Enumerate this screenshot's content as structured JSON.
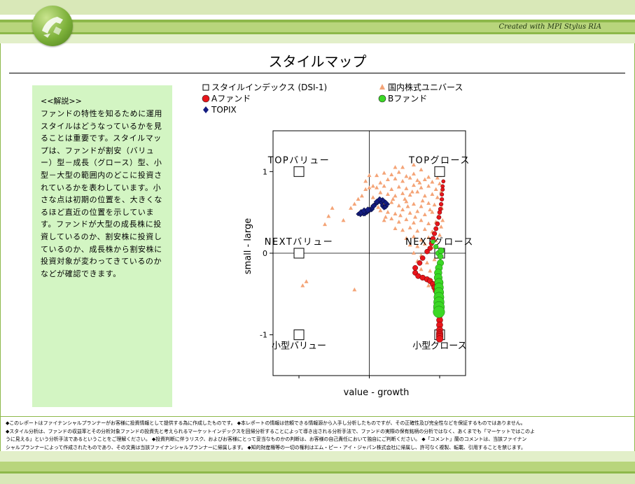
{
  "header": {
    "credit": "Created with MPI Stylus RIA"
  },
  "page_title": "スタイルマップ",
  "note": {
    "title": "<<解説>>",
    "body": "ファンドの特性を知るために運用スタイルはどうなっているかを見ることは重要です。スタイルマップは、ファンドが割安（バリュー）型－成長（グロース）型、小型－大型の範囲内のどこに投資されているかを表わしています。小さな点は初期の位置を、大きくなるほど直近の位置を示しています。ファンドが大型の成長株に投資しているのか、割安株に投資しているのか、成長株から割安株に投資対象が変わってきているのかなどが確認できます。"
  },
  "footer": {
    "lines": [
      "◆このレポートはファイナンシャルプランナーがお客様に投資情報として提供する為に作成したものです。 ◆本レポートの情報は信頼できる情報源から入手し分析したものですが、その正確性及び完全性などを保証するものではありません。",
      "◆スタイル分析は、ファンドの収益率とその分析対象ファンドの投資先と考えられるマーケットインデックスを回帰分析することによって導き出される分析手法で、ファンドの実際の保有銘柄の分析ではなく、あくまでも「マーケットではこのよ",
      "うに見える」という分析手法であるということをご理解ください。 ◆投資判断に伴うリスク、およびお客様にとって妥当なものかの判断は、お客様の自己責任において独自にご判断ください。 ◆「コメント」蘭のコメントは、当該ファイナン",
      "シャルプランナーによって作成されたものであり、その文責は当該ファイナンシャルプランナーに帰属します。 ◆知的財産権等の一切の権利はエム・ピー・アイ・ジャパン株式会社に帰属し、許可なく複製、転載、引用することを禁じます。"
    ]
  },
  "colors": {
    "band_dark": "#8db84a",
    "band_mid": "#b8d57c",
    "band_light": "#e2efc9",
    "note_bg": "#d3f5c3",
    "universe": "#f4a477",
    "fund_a": "#e8151b",
    "fund_b": "#3bd825",
    "topix": "#131c80"
  },
  "chart_data": {
    "type": "scatter",
    "xlabel": "value - growth",
    "ylabel": "small - large",
    "xlim": [
      -1.3,
      1.3
    ],
    "ylim": [
      -1.5,
      1.5
    ],
    "yticks": [
      "1",
      "0",
      "-1"
    ],
    "grid_cross": [
      0,
      0
    ],
    "legend": [
      {
        "label": "スタイルインデックス (DSI-1)",
        "marker": "square-open"
      },
      {
        "label": "国内株式ユニバース",
        "marker": "triangle"
      },
      {
        "label": "Aファンド",
        "marker": "circle"
      },
      {
        "label": "Bファンド",
        "marker": "circle"
      },
      {
        "label": "TOPIX",
        "marker": "diamond"
      }
    ],
    "style_indices": [
      {
        "label": "TOPバリュー",
        "x": -0.95,
        "y": 1.0
      },
      {
        "label": "TOPグロース",
        "x": 0.95,
        "y": 1.0
      },
      {
        "label": "NEXTバリュー",
        "x": -0.95,
        "y": 0.0
      },
      {
        "label": "NEXTグロース",
        "x": 0.95,
        "y": 0.0
      },
      {
        "label": "小型バリュー",
        "x": -0.95,
        "y": -1.0
      },
      {
        "label": "小型グロース",
        "x": 0.95,
        "y": -1.0
      }
    ],
    "series": [
      {
        "name": "国内株式ユニバース",
        "points": [
          [
            0.1,
            0.95
          ],
          [
            0.2,
            0.98
          ],
          [
            0.3,
            0.96
          ],
          [
            0.4,
            0.99
          ],
          [
            0.5,
            0.94
          ],
          [
            0.6,
            0.97
          ],
          [
            0.7,
            1.02
          ],
          [
            0.8,
            0.93
          ],
          [
            0.9,
            0.99
          ],
          [
            0.25,
            0.9
          ],
          [
            0.35,
            0.91
          ],
          [
            0.45,
            0.88
          ],
          [
            0.55,
            0.92
          ],
          [
            0.65,
            0.89
          ],
          [
            0.75,
            0.9
          ],
          [
            0.85,
            0.87
          ],
          [
            0.15,
            0.86
          ],
          [
            0.05,
            0.82
          ],
          [
            0.0,
            0.8
          ],
          [
            -0.05,
            0.78
          ],
          [
            0.1,
            0.8
          ],
          [
            0.2,
            0.82
          ],
          [
            0.3,
            0.78
          ],
          [
            0.4,
            0.81
          ],
          [
            0.5,
            0.79
          ],
          [
            0.6,
            0.83
          ],
          [
            0.7,
            0.8
          ],
          [
            0.8,
            0.82
          ],
          [
            0.9,
            0.78
          ],
          [
            0.95,
            0.85
          ],
          [
            0.15,
            0.74
          ],
          [
            0.25,
            0.72
          ],
          [
            0.35,
            0.7
          ],
          [
            0.45,
            0.73
          ],
          [
            0.55,
            0.71
          ],
          [
            0.65,
            0.75
          ],
          [
            0.75,
            0.7
          ],
          [
            0.85,
            0.72
          ],
          [
            0.92,
            0.68
          ],
          [
            -0.1,
            0.7
          ],
          [
            -0.15,
            0.66
          ],
          [
            0.05,
            0.68
          ],
          [
            0.1,
            0.64
          ],
          [
            0.2,
            0.6
          ],
          [
            0.3,
            0.62
          ],
          [
            0.4,
            0.58
          ],
          [
            0.5,
            0.63
          ],
          [
            0.6,
            0.6
          ],
          [
            0.7,
            0.57
          ],
          [
            0.8,
            0.61
          ],
          [
            0.88,
            0.59
          ],
          [
            -0.2,
            0.6
          ],
          [
            -0.25,
            0.55
          ],
          [
            0.15,
            0.52
          ],
          [
            0.25,
            0.5
          ],
          [
            0.35,
            0.48
          ],
          [
            0.45,
            0.53
          ],
          [
            0.55,
            0.49
          ],
          [
            0.65,
            0.51
          ],
          [
            0.75,
            0.47
          ],
          [
            0.85,
            0.5
          ],
          [
            0.93,
            0.45
          ],
          [
            0.2,
            0.4
          ],
          [
            0.3,
            0.42
          ],
          [
            0.4,
            0.38
          ],
          [
            0.5,
            0.41
          ],
          [
            0.6,
            0.37
          ],
          [
            0.7,
            0.4
          ],
          [
            0.8,
            0.36
          ],
          [
            0.9,
            0.38
          ],
          [
            0.97,
            0.32
          ],
          [
            0.35,
            0.3
          ],
          [
            0.45,
            0.28
          ],
          [
            0.55,
            0.31
          ],
          [
            0.65,
            0.27
          ],
          [
            0.75,
            0.29
          ],
          [
            0.85,
            0.26
          ],
          [
            0.95,
            0.22
          ],
          [
            0.5,
            0.18
          ],
          [
            0.6,
            0.2
          ],
          [
            0.7,
            0.16
          ],
          [
            0.8,
            0.19
          ],
          [
            0.9,
            0.15
          ],
          [
            0.55,
            0.1
          ],
          [
            0.65,
            0.08
          ],
          [
            0.75,
            0.11
          ],
          [
            0.85,
            0.07
          ],
          [
            0.95,
            0.05
          ],
          [
            0.6,
            0.0
          ],
          [
            0.7,
            -0.03
          ],
          [
            0.8,
            0.02
          ],
          [
            0.9,
            -0.05
          ],
          [
            0.65,
            -0.1
          ],
          [
            0.78,
            -0.12
          ],
          [
            0.88,
            -0.08
          ],
          [
            0.7,
            -0.2
          ],
          [
            0.82,
            -0.22
          ],
          [
            0.95,
            -0.18
          ],
          [
            0.75,
            -0.3
          ],
          [
            0.9,
            -0.33
          ],
          [
            0.8,
            -0.4
          ],
          [
            0.95,
            0.95
          ],
          [
            0.97,
            0.75
          ],
          [
            0.98,
            0.55
          ],
          [
            0.99,
            0.4
          ],
          [
            -0.85,
            -0.35
          ],
          [
            -0.9,
            -0.4
          ],
          [
            -0.2,
            -0.45
          ],
          [
            -0.35,
            0.4
          ],
          [
            -0.5,
            0.55
          ],
          [
            -0.6,
            0.35
          ],
          [
            -0.55,
            0.45
          ],
          [
            0.0,
            0.95
          ],
          [
            0.45,
            1.05
          ],
          [
            0.6,
            1.08
          ],
          [
            0.35,
            1.05
          ],
          [
            -0.05,
            0.88
          ],
          [
            0.22,
            0.44
          ],
          [
            0.12,
            0.56
          ],
          [
            0.32,
            0.66
          ],
          [
            0.42,
            0.46
          ],
          [
            0.52,
            0.57
          ],
          [
            0.62,
            0.44
          ],
          [
            0.72,
            0.64
          ],
          [
            0.82,
            0.53
          ],
          [
            0.92,
            0.92
          ],
          [
            0.68,
            0.86
          ],
          [
            0.58,
            0.75
          ],
          [
            0.48,
            0.66
          ]
        ]
      },
      {
        "name": "TOPIX",
        "points": [
          [
            -0.15,
            0.48
          ],
          [
            -0.12,
            0.47
          ],
          [
            -0.09,
            0.49
          ],
          [
            -0.06,
            0.48
          ],
          [
            -0.03,
            0.5
          ],
          [
            0.0,
            0.52
          ],
          [
            0.03,
            0.55
          ],
          [
            0.05,
            0.58
          ],
          [
            0.08,
            0.6
          ],
          [
            0.11,
            0.62
          ],
          [
            0.13,
            0.64
          ],
          [
            0.16,
            0.62
          ],
          [
            0.18,
            0.58
          ],
          [
            0.2,
            0.56
          ],
          [
            0.22,
            0.57
          ],
          [
            0.24,
            0.6
          ],
          [
            0.22,
            0.62
          ],
          [
            0.18,
            0.65
          ],
          [
            0.14,
            0.66
          ],
          [
            0.1,
            0.63
          ],
          [
            0.06,
            0.58
          ],
          [
            0.03,
            0.54
          ],
          [
            0.0,
            0.53
          ],
          [
            -0.04,
            0.51
          ],
          [
            -0.08,
            0.49
          ],
          [
            -0.11,
            0.5
          ],
          [
            -0.07,
            0.52
          ],
          [
            -0.02,
            0.53
          ]
        ]
      },
      {
        "name": "Aファンド",
        "points": [
          [
            1.0,
            0.88
          ],
          [
            0.99,
            0.82
          ],
          [
            0.99,
            0.78
          ],
          [
            0.98,
            0.72
          ],
          [
            0.98,
            0.66
          ],
          [
            0.97,
            0.6
          ],
          [
            0.96,
            0.54
          ],
          [
            0.95,
            0.5
          ],
          [
            0.94,
            0.44
          ],
          [
            0.92,
            0.36
          ],
          [
            0.9,
            0.3
          ],
          [
            0.88,
            0.24
          ],
          [
            0.86,
            0.18
          ],
          [
            0.84,
            0.12
          ],
          [
            0.82,
            0.06
          ],
          [
            0.78,
            0.02
          ],
          [
            0.72,
            -0.06
          ],
          [
            0.68,
            -0.12
          ],
          [
            0.62,
            -0.18
          ],
          [
            0.62,
            -0.24
          ],
          [
            0.66,
            -0.28
          ],
          [
            0.72,
            -0.3
          ],
          [
            0.78,
            -0.32
          ],
          [
            0.82,
            -0.34
          ],
          [
            0.86,
            -0.38
          ],
          [
            0.88,
            -0.42
          ],
          [
            0.9,
            -0.46
          ],
          [
            0.92,
            -0.52
          ],
          [
            0.93,
            -0.58
          ],
          [
            0.94,
            -0.64
          ],
          [
            0.94,
            -0.7
          ],
          [
            0.95,
            -0.76
          ],
          [
            0.95,
            -0.82
          ],
          [
            0.95,
            -0.88
          ],
          [
            0.95,
            -0.94
          ],
          [
            0.95,
            -0.98
          ],
          [
            0.95,
            -1.0
          ],
          [
            0.95,
            -1.02
          ],
          [
            0.95,
            -1.05
          ]
        ]
      },
      {
        "name": "Bファンド",
        "points": [
          [
            0.86,
            0.14
          ],
          [
            0.9,
            0.08
          ],
          [
            0.93,
            0.0
          ],
          [
            0.96,
            -0.04
          ],
          [
            0.97,
            0.03
          ],
          [
            0.96,
            -0.12
          ],
          [
            0.94,
            -0.18
          ],
          [
            0.93,
            -0.24
          ],
          [
            0.93,
            -0.3
          ],
          [
            0.94,
            -0.36
          ],
          [
            0.94,
            -0.42
          ],
          [
            0.94,
            -0.48
          ],
          [
            0.94,
            -0.54
          ],
          [
            0.94,
            -0.6
          ],
          [
            0.94,
            -0.66
          ],
          [
            0.94,
            -0.72
          ]
        ]
      }
    ]
  }
}
